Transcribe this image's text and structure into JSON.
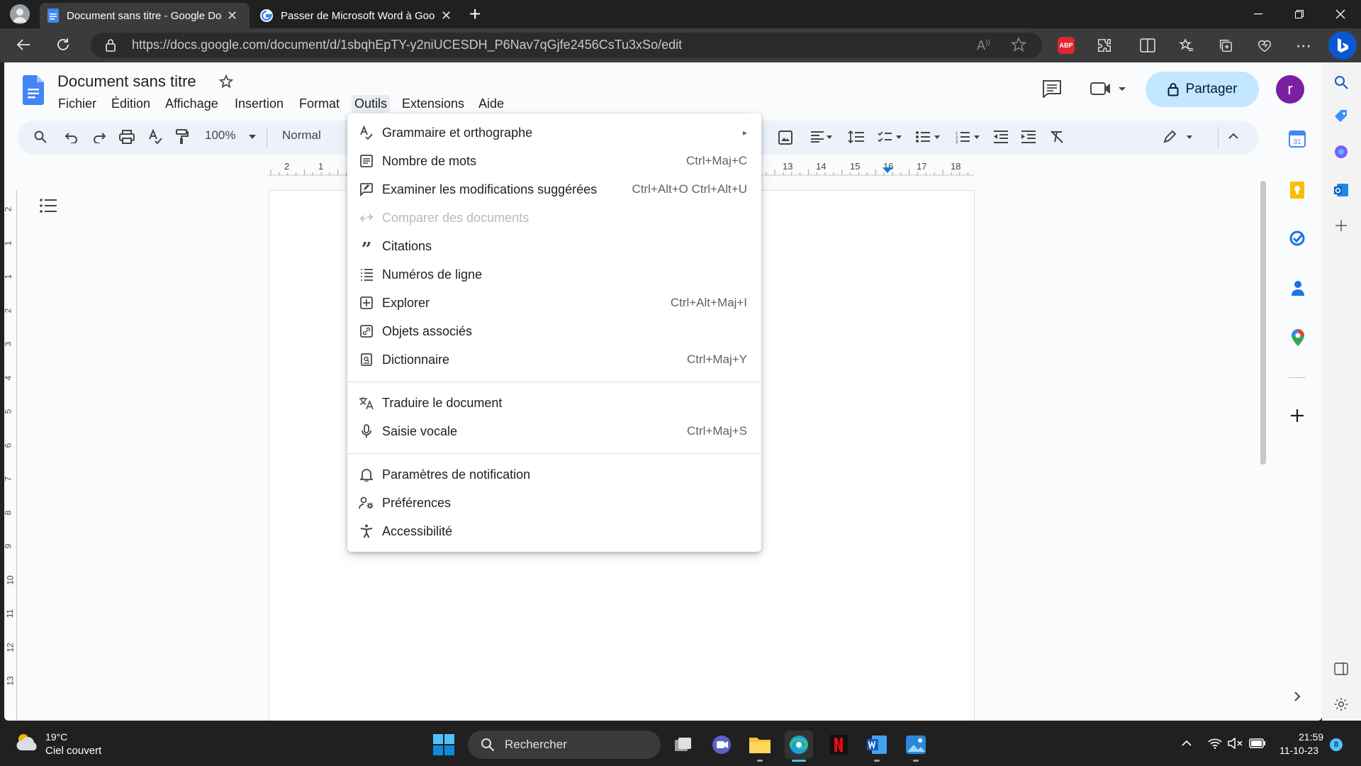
{
  "browser": {
    "tabs": [
      {
        "title": "Document sans titre - Google Docs",
        "close": "✕"
      },
      {
        "title": "Passer de Microsoft Word à Google Docs",
        "close": "✕"
      }
    ],
    "new_tab": "+",
    "url": "https://docs.google.com/document/d/1sbqhEpTY-y2niUCESDH_P6Nav7qGjfe2456CsTu3xSo/edit",
    "abp_badge": "ABP"
  },
  "docs": {
    "title": "Document sans titre",
    "menu": [
      "Fichier",
      "Édition",
      "Affichage",
      "Insertion",
      "Format",
      "Outils",
      "Extensions",
      "Aide"
    ],
    "active_menu": "Outils",
    "zoom": "100%",
    "style": "Normal",
    "share_label": "Partager",
    "avatar_letter": "r",
    "ruler_left": [
      "2",
      "1"
    ],
    "ruler_right": [
      "13",
      "14",
      "15",
      "16",
      "17",
      "18"
    ],
    "vruler": [
      "2",
      "1",
      "1",
      "2",
      "3",
      "4",
      "5",
      "6",
      "7",
      "8",
      "9",
      "10",
      "11",
      "12",
      "13"
    ]
  },
  "tools_menu": {
    "groups": [
      [
        {
          "label": "Grammaire et orthographe",
          "shortcut": "",
          "submenu": "▸",
          "icon": "spellcheck-icon"
        },
        {
          "label": "Nombre de mots",
          "shortcut": "Ctrl+Maj+C",
          "icon": "word-count-icon"
        },
        {
          "label": "Examiner les modifications suggérées",
          "shortcut": "Ctrl+Alt+O Ctrl+Alt+U",
          "icon": "review-edits-icon"
        },
        {
          "label": "Comparer des documents",
          "shortcut": "",
          "disabled": true,
          "icon": "compare-icon"
        },
        {
          "label": "Citations",
          "shortcut": "",
          "icon": "quote-icon"
        },
        {
          "label": "Numéros de ligne",
          "shortcut": "",
          "icon": "line-numbers-icon"
        },
        {
          "label": "Explorer",
          "shortcut": "Ctrl+Alt+Maj+I",
          "icon": "explore-icon"
        },
        {
          "label": "Objets associés",
          "shortcut": "",
          "icon": "linked-objects-icon"
        },
        {
          "label": "Dictionnaire",
          "shortcut": "Ctrl+Maj+Y",
          "icon": "dictionary-icon"
        }
      ],
      [
        {
          "label": "Traduire le document",
          "shortcut": "",
          "icon": "translate-icon"
        },
        {
          "label": "Saisie vocale",
          "shortcut": "Ctrl+Maj+S",
          "icon": "microphone-icon"
        }
      ],
      [
        {
          "label": "Paramètres de notification",
          "shortcut": "",
          "icon": "bell-icon"
        },
        {
          "label": "Préférences",
          "shortcut": "",
          "icon": "preferences-icon"
        },
        {
          "label": "Accessibilité",
          "shortcut": "",
          "icon": "accessibility-icon"
        }
      ]
    ]
  },
  "taskbar": {
    "weather_temp": "19°C",
    "weather_desc": "Ciel couvert",
    "search_placeholder": "Rechercher",
    "time": "21:59",
    "date": "11-10-23",
    "notification_count": "8"
  },
  "colors": {
    "docs_blue": "#4285f4",
    "share_bg": "#c2e7ff",
    "avatar": "#7b1fa2",
    "abp_red": "#e0262e"
  }
}
